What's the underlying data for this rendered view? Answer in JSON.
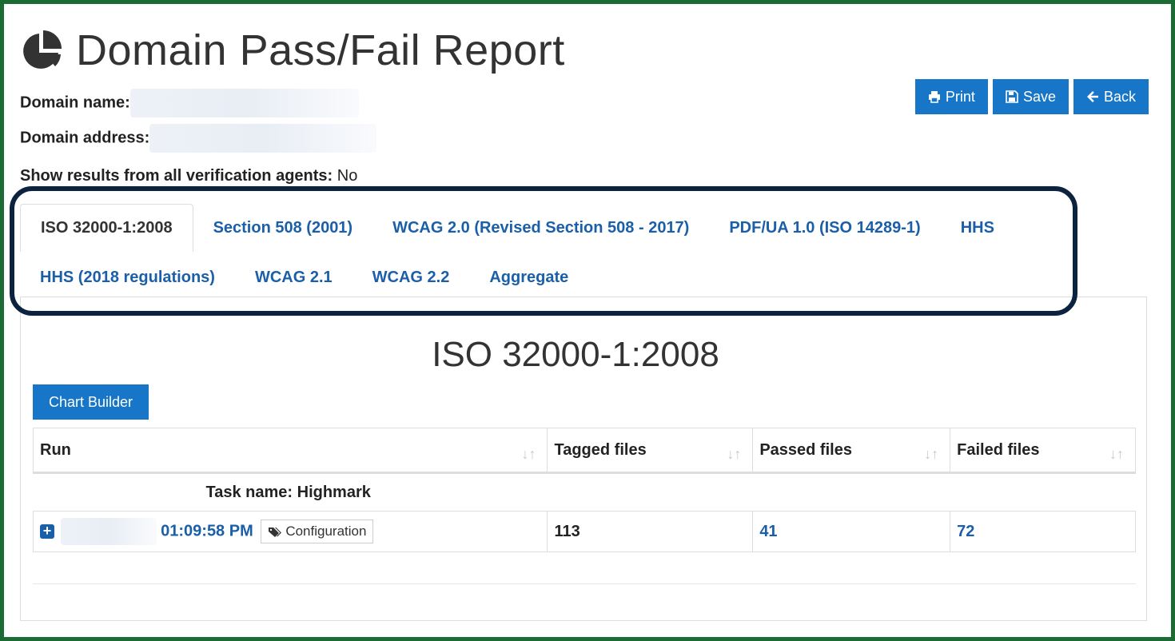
{
  "header": {
    "title": "Domain Pass/Fail Report",
    "icon": "pie-chart-icon"
  },
  "meta": {
    "domain_name_label": "Domain name:",
    "domain_address_label": "Domain address:",
    "agents_label": "Show results from all verification agents:",
    "agents_value": "No"
  },
  "toolbar": {
    "print_label": "Print",
    "save_label": "Save",
    "back_label": "Back"
  },
  "tabs": [
    {
      "label": "ISO 32000-1:2008",
      "active": true
    },
    {
      "label": "Section 508 (2001)"
    },
    {
      "label": "WCAG 2.0 (Revised Section 508 - 2017)"
    },
    {
      "label": "PDF/UA 1.0 (ISO 14289-1)"
    },
    {
      "label": "HHS"
    },
    {
      "label": "HHS (2018 regulations)"
    },
    {
      "label": "WCAG 2.1"
    },
    {
      "label": "WCAG 2.2"
    },
    {
      "label": "Aggregate"
    }
  ],
  "section": {
    "title": "ISO 32000-1:2008",
    "chart_builder_label": "Chart Builder"
  },
  "table": {
    "columns": [
      "Run",
      "Tagged files",
      "Passed files",
      "Failed files"
    ],
    "sort_glyph": "↓↑",
    "task_label": "Task name: Highmark",
    "run": {
      "expand_glyph": "+",
      "time": "01:09:58 PM",
      "config_label": "Configuration",
      "tagged": "113",
      "passed": "41",
      "failed": "72"
    }
  },
  "colors": {
    "accent": "#1876c9",
    "link": "#1a5fa8",
    "frame": "#1c6b34",
    "highlight": "#0c2340"
  }
}
